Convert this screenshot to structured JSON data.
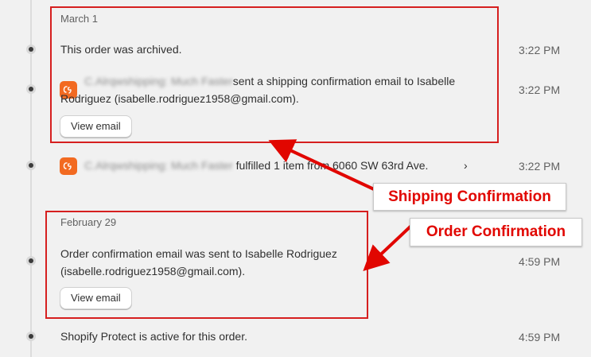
{
  "timeline": {
    "groups": [
      {
        "date": "March 1",
        "events": [
          {
            "text": "This order was archived.",
            "time": "3:22 PM"
          },
          {
            "actor_blurred": "C.Alrqwshipping: Much Faster",
            "text_line1": "sent a shipping confirmation email to Isabelle",
            "text_line2": "Rodriguez (isabelle.rodriguez1958@gmail.com).",
            "time": "3:22 PM",
            "button_label": "View email",
            "icon": "app-logo-icon"
          },
          {
            "actor_blurred": "C.Alrqwshipping: Much Faster",
            "text": "fulfilled 1 item from 6060 SW 63rd Ave.",
            "time": "3:22 PM",
            "icon": "app-logo-icon",
            "chevron": "chevron-right-icon"
          }
        ]
      },
      {
        "date": "February 29",
        "events": [
          {
            "text_line1": "Order confirmation email was sent to Isabelle Rodriguez",
            "text_line2": "(isabelle.rodriguez1958@gmail.com).",
            "time": "4:59 PM",
            "button_label": "View email"
          },
          {
            "text": "Shopify Protect is active for this order.",
            "time": "4:59 PM"
          }
        ]
      }
    ]
  },
  "annotations": {
    "shipping_label": "Shipping Confirmation",
    "order_label": "Order Confirmation",
    "color": "#e10600"
  }
}
